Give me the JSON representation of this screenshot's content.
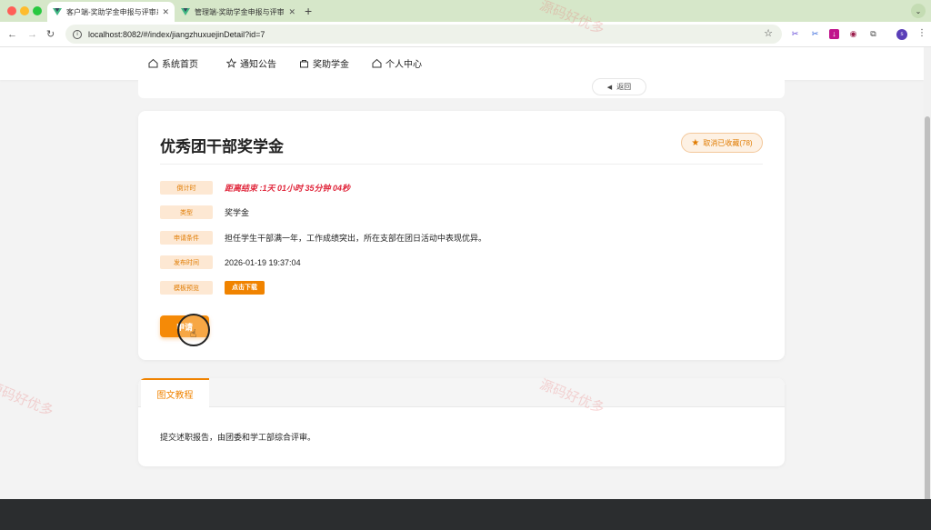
{
  "browser": {
    "tabs": [
      {
        "title": "客户端-奖助学金申报与评审系统",
        "active": true
      },
      {
        "title": "管理端-奖助学金申报与评审系统",
        "active": false
      }
    ],
    "url": "localhost:8082/#/index/jiangzhuxuejinDetail?id=7",
    "new_tab": "+",
    "profile_initial": "s"
  },
  "nav": {
    "items": [
      {
        "label": "系统首页",
        "icon": "home-icon"
      },
      {
        "label": "通知公告",
        "icon": "star-icon"
      },
      {
        "label": "奖助学金",
        "icon": "bag-icon"
      },
      {
        "label": "个人中心",
        "icon": "home-icon"
      }
    ]
  },
  "back_button": {
    "label": "返回"
  },
  "detail": {
    "title": "优秀团干部奖学金",
    "favorite_label": "取消已收藏(78)",
    "rows": [
      {
        "label": "倒计时",
        "value": "距离结束 :1天 01小时 35分钟 04秒"
      },
      {
        "label": "类型",
        "value": "奖学金"
      },
      {
        "label": "申请条件",
        "value": "担任学生干部满一年，工作成绩突出，所在支部在团日活动中表现优异。"
      },
      {
        "label": "发布时间",
        "value": "2026-01-19 19:37:04"
      },
      {
        "label": "模板预览",
        "value": "点击下载"
      }
    ],
    "apply_label": "申请"
  },
  "tutorial": {
    "tab_label": "图文教程",
    "content": "提交述职报告，由团委和学工部综合评审。"
  },
  "watermark_text": "源码好优多",
  "colors": {
    "accent": "#f08300",
    "countdown": "#e0263b",
    "label_bg": "#fde8d3"
  }
}
